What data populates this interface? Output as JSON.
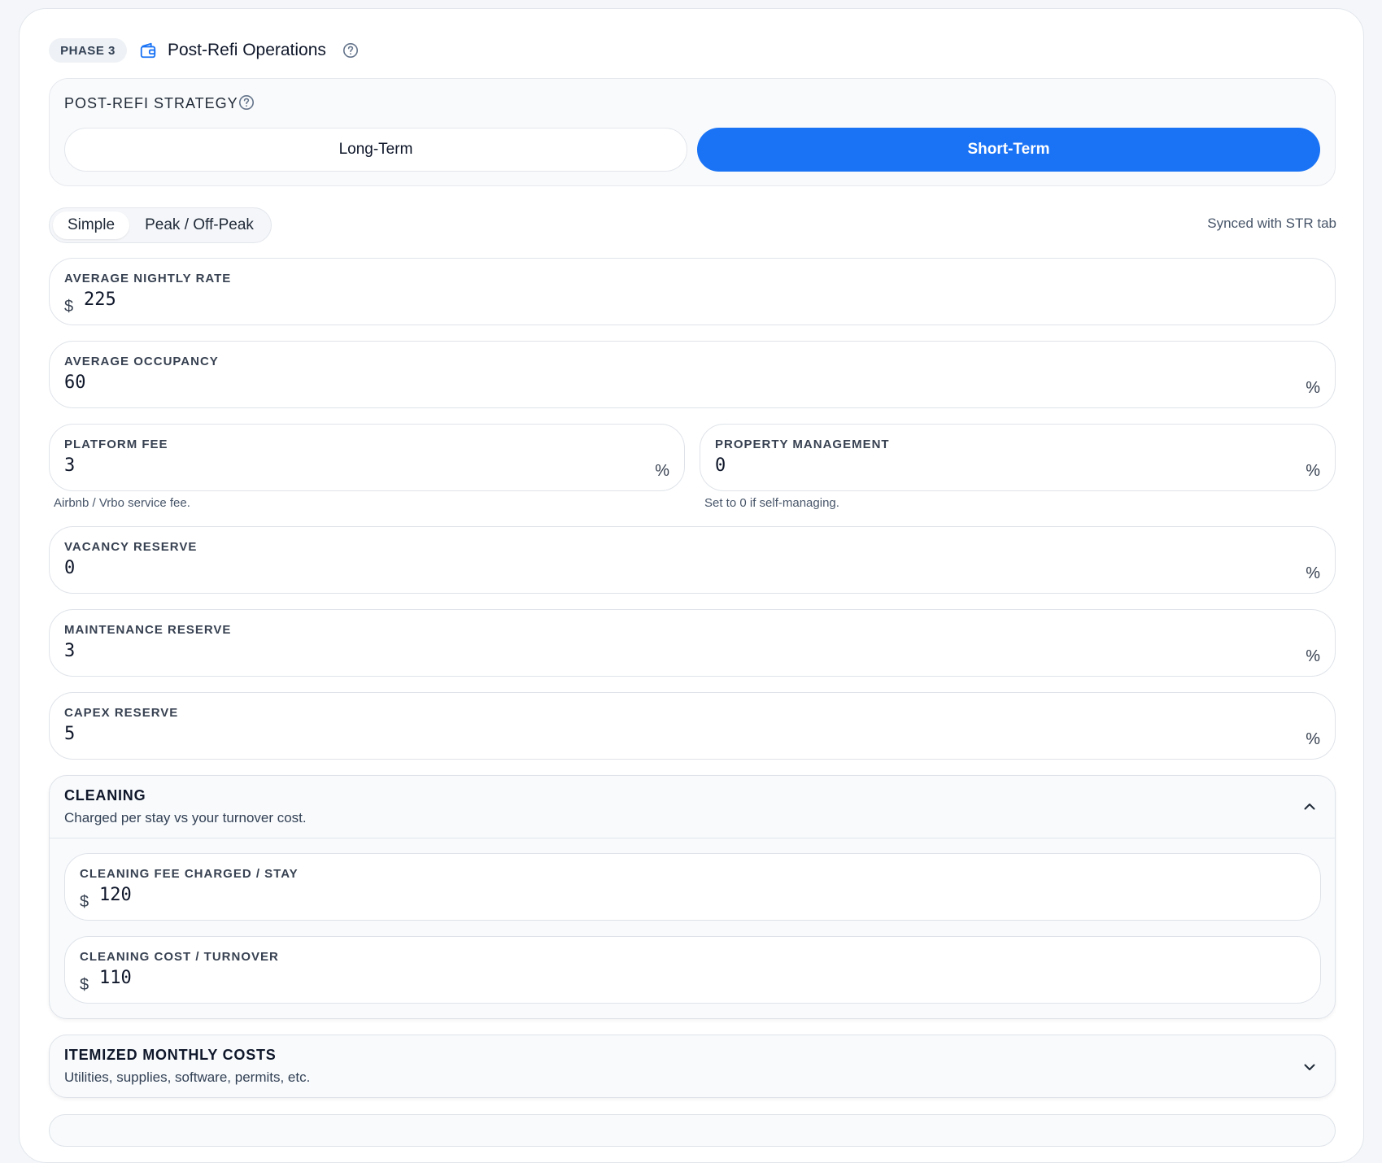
{
  "header": {
    "phase_badge": "PHASE 3",
    "title": "Post-Refi Operations",
    "icon": "wallet-icon",
    "help_icon": "question-circle-icon"
  },
  "strategy": {
    "label": "POST-REFI STRATEGY",
    "options": [
      {
        "label": "Long-Term",
        "selected": false
      },
      {
        "label": "Short-Term",
        "selected": true
      }
    ],
    "accent_color": "#1a73f5"
  },
  "mode": {
    "options": [
      {
        "label": "Simple",
        "selected": true
      },
      {
        "label": "Peak / Off-Peak",
        "selected": false
      }
    ],
    "synced_note": "Synced with STR tab"
  },
  "fields": {
    "nightly_rate": {
      "label": "AVERAGE NIGHTLY RATE",
      "prefix": "$",
      "value": "225"
    },
    "occupancy": {
      "label": "AVERAGE OCCUPANCY",
      "value": "60",
      "suffix": "%"
    },
    "platform_fee": {
      "label": "PLATFORM FEE",
      "value": "3",
      "suffix": "%",
      "hint": "Airbnb / Vrbo service fee."
    },
    "property_mgmt": {
      "label": "PROPERTY MANAGEMENT",
      "value": "0",
      "suffix": "%",
      "hint": "Set to 0 if self-managing."
    },
    "vacancy": {
      "label": "VACANCY RESERVE",
      "value": "0",
      "suffix": "%"
    },
    "maintenance": {
      "label": "MAINTENANCE RESERVE",
      "value": "3",
      "suffix": "%"
    },
    "capex": {
      "label": "CAPEX RESERVE",
      "value": "5",
      "suffix": "%"
    }
  },
  "cleaning": {
    "title": "CLEANING",
    "subtitle": "Charged per stay vs your turnover cost.",
    "expanded": true,
    "fee_charged": {
      "label": "CLEANING FEE CHARGED / STAY",
      "prefix": "$",
      "value": "120"
    },
    "cost_turnover": {
      "label": "CLEANING COST / TURNOVER",
      "prefix": "$",
      "value": "110"
    }
  },
  "itemized": {
    "title": "ITEMIZED MONTHLY COSTS",
    "subtitle": "Utilities, supplies, software, permits, etc.",
    "expanded": false
  }
}
